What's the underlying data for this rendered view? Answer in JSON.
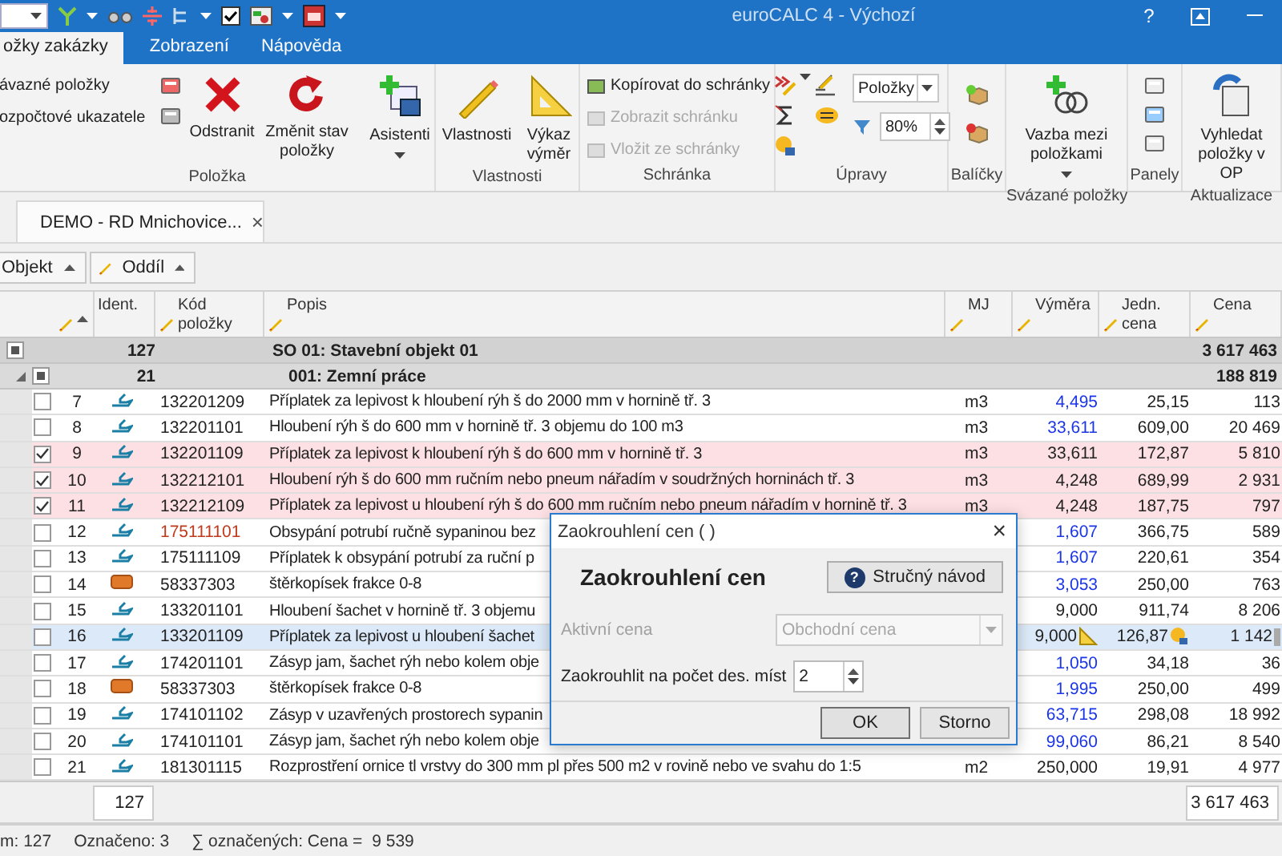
{
  "window": {
    "title": "euroCALC 4 - Výchozí",
    "help": "?"
  },
  "ribbon": {
    "tabs": [
      {
        "label": "ožky zakázky",
        "selected": true
      },
      {
        "label": "Zobrazení",
        "selected": false
      },
      {
        "label": "Nápověda",
        "selected": false
      }
    ],
    "groups": [
      {
        "label": "Položka",
        "links": [
          {
            "label": "ávazné položky",
            "disabled": false
          },
          {
            "label": "ozpočtové ukazatele",
            "disabled": false
          }
        ],
        "buttons": [
          {
            "label": "Odstranit",
            "dropdown": false
          },
          {
            "label": "Změnit stav položky",
            "dropdown": false
          },
          {
            "label": "Asistenti",
            "dropdown": true
          }
        ]
      },
      {
        "label": "Vlastnosti",
        "buttons": [
          {
            "label": "Vlastnosti",
            "dropdown": false
          },
          {
            "label": "Výkaz výměr",
            "dropdown": false
          }
        ]
      },
      {
        "label": "Schránka",
        "links": [
          {
            "label": "Kopírovat do schránky",
            "disabled": false
          },
          {
            "label": "Zobrazit schránku",
            "disabled": true
          },
          {
            "label": "Vložit ze schránky",
            "disabled": true
          }
        ]
      },
      {
        "label": "Úpravy",
        "view_select": "Položky",
        "zoom": "80%"
      },
      {
        "label": "Balíčky"
      },
      {
        "label": "Svázané položky",
        "buttons": [
          {
            "label": "Vazba mezi položkami",
            "dropdown": true
          }
        ]
      },
      {
        "label": "Panely"
      },
      {
        "label": "Aktualizace",
        "buttons": [
          {
            "label": "Vyhledat položky v OP",
            "dropdown": false
          }
        ]
      }
    ]
  },
  "document_tab": {
    "title": "DEMO - RD Mnichovice...",
    "close": "×"
  },
  "group_by": [
    {
      "label": "Objekt"
    },
    {
      "label": "Oddíl"
    }
  ],
  "table": {
    "columns": [
      {
        "label": "Ident."
      },
      {
        "label": "Kód položky"
      },
      {
        "label": "Popis"
      },
      {
        "label": "MJ"
      },
      {
        "label": "Výměra"
      },
      {
        "label": "Jedn. cena"
      },
      {
        "label": "Cena"
      }
    ],
    "groups": [
      {
        "kind": "object",
        "partially_checked": true,
        "count": "127",
        "title": "SO 01: Stavební objekt 01",
        "price": "3 617 463"
      },
      {
        "kind": "section",
        "partially_checked": true,
        "count": "21",
        "title": "001: Zemní práce",
        "price": "188 819"
      }
    ],
    "rows": [
      {
        "checked": false,
        "selected": false,
        "number": "7",
        "kind": "work",
        "code": "132201209",
        "code_flagged": false,
        "description": "Příplatek za lepivost k hloubení rýh š do 2000 mm v hornině tř. 3",
        "unit": "m3",
        "quantity": "4,495",
        "quantity_linked": true,
        "unit_price": "25,15",
        "price": "113"
      },
      {
        "checked": false,
        "selected": false,
        "number": "8",
        "kind": "work",
        "code": "132201101",
        "code_flagged": false,
        "description": "Hloubení rýh š do 600 mm v hornině tř. 3 objemu do 100 m3",
        "unit": "m3",
        "quantity": "33,611",
        "quantity_linked": true,
        "unit_price": "609,00",
        "price": "20 469"
      },
      {
        "checked": true,
        "selected": false,
        "number": "9",
        "kind": "work",
        "code": "132201109",
        "code_flagged": false,
        "description": "Příplatek za lepivost k hloubení rýh š do 600 mm v hornině tř. 3",
        "unit": "m3",
        "quantity": "33,611",
        "quantity_linked": false,
        "unit_price": "172,87",
        "price": "5 810"
      },
      {
        "checked": true,
        "selected": false,
        "number": "10",
        "kind": "work",
        "code": "132212101",
        "code_flagged": false,
        "description": "Hloubení rýh š do 600 mm ručním nebo pneum nářadím v soudržných horninách tř. 3",
        "unit": "m3",
        "quantity": "4,248",
        "quantity_linked": false,
        "unit_price": "689,99",
        "price": "2 931"
      },
      {
        "checked": true,
        "selected": false,
        "number": "11",
        "kind": "work",
        "code": "132212109",
        "code_flagged": false,
        "description": "Příplatek za lepivost u hloubení rýh š do 600 mm ručním nebo pneum nářadím v hornině tř. 3",
        "unit": "m3",
        "quantity": "4,248",
        "quantity_linked": false,
        "unit_price": "187,75",
        "price": "797"
      },
      {
        "checked": false,
        "selected": false,
        "number": "12",
        "kind": "work",
        "code": "175111101",
        "code_flagged": true,
        "description": "Obsypání potrubí ručně sypaninou bez",
        "quantity": "1,607",
        "quantity_linked": true,
        "unit_price": "366,75",
        "price": "589"
      },
      {
        "checked": false,
        "selected": false,
        "number": "13",
        "kind": "work",
        "code": "175111109",
        "code_flagged": false,
        "description": "Příplatek k obsypání potrubí za ruční p",
        "quantity": "1,607",
        "quantity_linked": true,
        "unit_price": "220,61",
        "price": "354"
      },
      {
        "checked": false,
        "selected": false,
        "number": "14",
        "kind": "material",
        "code": "58337303",
        "code_flagged": false,
        "description": "štěrkopísek frakce 0-8",
        "quantity": "3,053",
        "quantity_linked": true,
        "unit_price": "250,00",
        "price": "763"
      },
      {
        "checked": false,
        "selected": false,
        "number": "15",
        "kind": "work",
        "code": "133201101",
        "code_flagged": false,
        "description": "Hloubení šachet v hornině tř. 3 objemu",
        "quantity": "9,000",
        "quantity_linked": false,
        "unit_price": "911,74",
        "price": "8 206"
      },
      {
        "checked": false,
        "selected": true,
        "number": "16",
        "kind": "work",
        "code": "133201109",
        "code_flagged": false,
        "description": "Příplatek za lepivost u hloubení šachet",
        "quantity": "9,000",
        "quantity_linked": false,
        "unit_price": "126,87",
        "price": "1 142"
      },
      {
        "checked": false,
        "selected": false,
        "number": "17",
        "kind": "work",
        "code": "174201101",
        "code_flagged": false,
        "description": "Zásyp jam, šachet rýh nebo kolem obje",
        "quantity": "1,050",
        "quantity_linked": true,
        "unit_price": "34,18",
        "price": "36"
      },
      {
        "checked": false,
        "selected": false,
        "number": "18",
        "kind": "material",
        "code": "58337303",
        "code_flagged": false,
        "description": "štěrkopísek frakce 0-8",
        "quantity": "1,995",
        "quantity_linked": true,
        "unit_price": "250,00",
        "price": "499"
      },
      {
        "checked": false,
        "selected": false,
        "number": "19",
        "kind": "work",
        "code": "174101102",
        "code_flagged": false,
        "description": "Zásyp v uzavřených prostorech sypanin",
        "quantity": "63,715",
        "quantity_linked": true,
        "unit_price": "298,08",
        "price": "18 992"
      },
      {
        "checked": false,
        "selected": false,
        "number": "20",
        "kind": "work",
        "code": "174101101",
        "code_flagged": false,
        "description": "Zásyp jam, šachet rýh nebo kolem obje",
        "quantity": "99,060",
        "quantity_linked": true,
        "unit_price": "86,21",
        "price": "8 540"
      },
      {
        "checked": false,
        "selected": false,
        "number": "21",
        "kind": "work",
        "code": "181301115",
        "code_flagged": false,
        "description": "Rozprostření ornice tl vrstvy do 300 mm pl přes 500 m2 v rovině nebo ve svahu do 1:5",
        "unit": "m2",
        "quantity": "250,000",
        "quantity_linked": false,
        "unit_price": "19,91",
        "price": "4 977"
      }
    ],
    "footer": {
      "count": "127",
      "total": "3 617 463"
    }
  },
  "dialog": {
    "title": "Zaokrouhlení cen ( )",
    "close": "×",
    "heading": "Zaokrouhlení cen",
    "help_icon": "?",
    "help_button": "Stručný návod",
    "fields": [
      {
        "kind": "select",
        "label": "Aktivní cena",
        "value": "Obchodní cena",
        "disabled": true
      },
      {
        "kind": "spin",
        "label": "Zaokrouhlit na počet des. míst",
        "value": "2",
        "disabled": false
      }
    ],
    "buttons": [
      {
        "label": "OK",
        "default": true
      },
      {
        "label": "Storno",
        "default": false
      }
    ]
  },
  "status_bar": [
    {
      "label": "m: 127"
    },
    {
      "label": "Označeno: 3"
    },
    {
      "label": "∑ označených: Cena =",
      "value": "9 539"
    }
  ]
}
